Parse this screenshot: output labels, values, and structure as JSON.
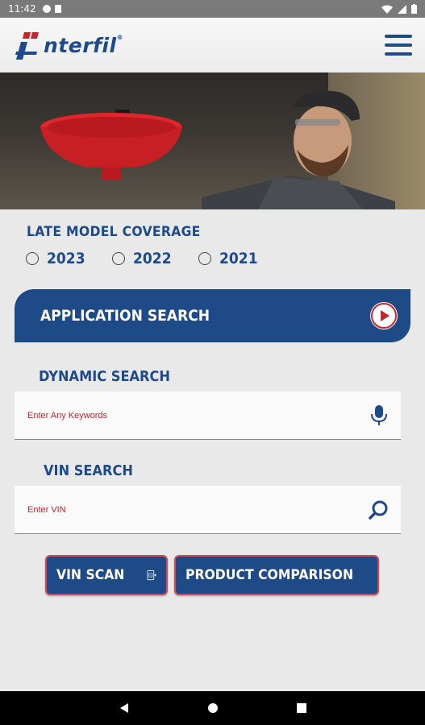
{
  "status_bar": {
    "time": "11:42"
  },
  "header": {
    "logo_text": "nterfil",
    "logo_mark": "®"
  },
  "coverage": {
    "title": "LATE MODEL COVERAGE",
    "years": [
      "2023",
      "2022",
      "2021"
    ]
  },
  "application_search": {
    "label": "APPLICATION SEARCH"
  },
  "dynamic_search": {
    "title": "DYNAMIC SEARCH",
    "placeholder": "Enter Any Keywords"
  },
  "vin_search": {
    "title": "VIN SEARCH",
    "placeholder": "Enter VIN"
  },
  "buttons": {
    "vin_scan": "VIN SCAN",
    "product_comparison": "PRODUCT COMPARISON"
  },
  "colors": {
    "brand_blue": "#1f4a88",
    "brand_red": "#c4262e"
  }
}
